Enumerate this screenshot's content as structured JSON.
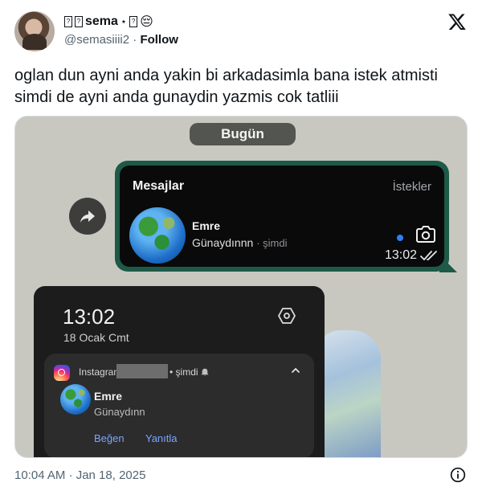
{
  "author": {
    "display_name": "sema",
    "name_prefix_glyphs": [
      "?",
      "?"
    ],
    "name_suffix_glyph": "?",
    "name_emoji": "😔",
    "handle": "@semasiiii2",
    "separator": "·",
    "follow_label": "Follow"
  },
  "tweet": {
    "text": "oglan dun ayni anda yakin bi arkadasimla bana istek atmisti simdi de ayni anda gunaydin yazmis cok tatliii",
    "timestamp": "10:04 AM · Jan 18, 2025"
  },
  "media": {
    "date_pill": "Bugün",
    "instagram_card": {
      "title": "Mesajlar",
      "requests_label": "İstekler",
      "sender": "Emre",
      "message": "Günaydınnn",
      "message_time": "· şimdi",
      "bubble_time": "13:02"
    },
    "phone": {
      "time": "13:02",
      "date": "18 Ocak Cmt",
      "notification": {
        "app": "Instagram",
        "time": "• şimdi",
        "sender": "Emre",
        "message": "Günaydınn",
        "action_like": "Beğen",
        "action_reply": "Yanıtla"
      }
    }
  },
  "icons": [
    "x-logo-icon",
    "forward-icon",
    "camera-icon",
    "double-check-icon",
    "settings-hexagon-icon",
    "instagram-icon",
    "bell-icon",
    "chevron-up-icon",
    "info-icon",
    "globe-emoji-icon"
  ]
}
